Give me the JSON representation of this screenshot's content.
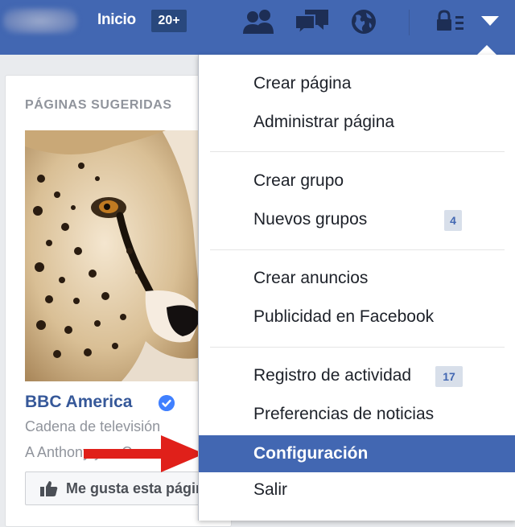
{
  "topbar": {
    "home_label": "Inicio",
    "home_badge": "20+",
    "icons": [
      "friend-requests-icon",
      "messages-icon",
      "notifications-globe-icon",
      "privacy-shortcuts-icon",
      "account-menu-caret-icon"
    ],
    "bar_color": "#4267b2"
  },
  "suggested": {
    "title": "PÁGINAS SUGERIDAS",
    "page_name": "BBC America",
    "category": "Cadena de televisión",
    "friends_text": "A Anthony y ... Comentó",
    "like_button": "Me gusta esta página"
  },
  "menu": {
    "items": [
      {
        "label": "Crear página"
      },
      {
        "label": "Administrar página"
      },
      {
        "label": "Crear grupo"
      },
      {
        "label": "Nuevos grupos",
        "count": "4"
      },
      {
        "label": "Crear anuncios"
      },
      {
        "label": "Publicidad en Facebook"
      },
      {
        "label": "Registro de actividad",
        "count": "17"
      },
      {
        "label": "Preferencias de noticias"
      },
      {
        "label": "Configuración",
        "selected": true
      },
      {
        "label": "Salir"
      }
    ],
    "highlight_color": "#4267b2"
  },
  "annotation": {
    "arrow_color": "#e0201a"
  }
}
